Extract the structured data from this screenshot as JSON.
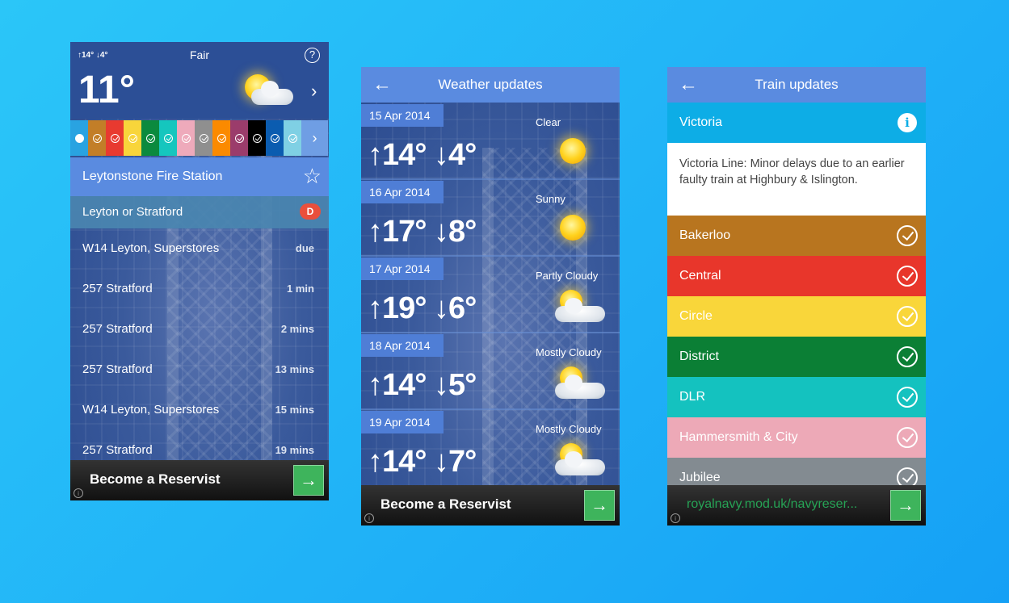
{
  "screen1": {
    "hi_lo": "↑14° ↓4°",
    "condition": "Fair",
    "temperature": "11°",
    "help_icon": "?",
    "next_icon": "›",
    "line_colors": [
      "#c27e28",
      "#e83a30",
      "#f8d53b",
      "#0b8a3e",
      "#15c6be",
      "#eeaabb",
      "#8f8f8f",
      "#fb8a00",
      "#9b3c6b",
      "#000000",
      "#0b5cb0",
      "#7fd0e4"
    ],
    "station": "Leytonstone Fire Station",
    "route_label": "Leyton or Stratford",
    "route_badge": "D",
    "departures": [
      {
        "service": "W14 Leyton, Superstores",
        "time": "due"
      },
      {
        "service": "257 Stratford",
        "time": "1 min"
      },
      {
        "service": "257 Stratford",
        "time": "2 mins"
      },
      {
        "service": "257 Stratford",
        "time": "13 mins"
      },
      {
        "service": "W14 Leyton, Superstores",
        "time": "15 mins"
      },
      {
        "service": "257 Stratford",
        "time": "19 mins"
      }
    ],
    "ad_text": "Become a Reservist"
  },
  "screen2": {
    "title": "Weather updates",
    "forecasts": [
      {
        "date": "15 Apr 2014",
        "condition": "Clear",
        "high_low": "↑14° ↓4°",
        "icon": "sun-icon"
      },
      {
        "date": "16 Apr 2014",
        "condition": "Sunny",
        "high_low": "↑17° ↓8°",
        "icon": "sun-icon"
      },
      {
        "date": "17 Apr 2014",
        "condition": "Partly Cloudy",
        "high_low": "↑19° ↓6°",
        "icon": "partly-cloudy-icon"
      },
      {
        "date": "18 Apr 2014",
        "condition": "Mostly Cloudy",
        "high_low": "↑14° ↓5°",
        "icon": "mostly-cloudy-icon"
      },
      {
        "date": "19 Apr 2014",
        "condition": "Mostly Cloudy",
        "high_low": "↑14° ↓7°",
        "icon": "mostly-cloudy-icon"
      }
    ],
    "ad_text": "Become a Reservist"
  },
  "screen3": {
    "title": "Train updates",
    "selected_line": "Victoria",
    "selected_color": "#0dade6",
    "status_message": "Victoria Line: Minor delays due to an earlier faulty train at Highbury & Islington.",
    "lines": [
      {
        "name": "Bakerloo",
        "color": "#b8751f"
      },
      {
        "name": "Central",
        "color": "#e8362b"
      },
      {
        "name": "Circle",
        "color": "#f9d63a"
      },
      {
        "name": "District",
        "color": "#0b7f35"
      },
      {
        "name": "DLR",
        "color": "#14c2bf"
      },
      {
        "name": "Hammersmith & City",
        "color": "#eda9b7"
      },
      {
        "name": "Jubilee",
        "color": "#838b91"
      }
    ],
    "ad_url": "royalnavy.mod.uk/navyreser..."
  },
  "ad_button_icon": "→",
  "ad_info_icon": "i"
}
